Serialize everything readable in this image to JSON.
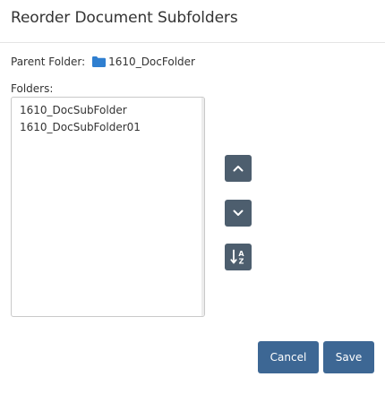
{
  "dialog": {
    "title": "Reorder Document Subfolders"
  },
  "parent_folder": {
    "label": "Parent Folder:",
    "icon": "folder-icon",
    "value": "1610_DocFolder"
  },
  "folders": {
    "label": "Folders:",
    "items": [
      {
        "label": "1610_DocSubFolder"
      },
      {
        "label": "1610_DocSubFolder01"
      }
    ]
  },
  "controls": {
    "move_up_icon": "chevron-up-icon",
    "move_down_icon": "chevron-down-icon",
    "sort_icon": "sort-alpha-icon",
    "sort_letters": [
      "A",
      "Z"
    ]
  },
  "footer": {
    "cancel_label": "Cancel",
    "save_label": "Save"
  },
  "colors": {
    "primary_button": "#3d6794",
    "icon_button": "#4d5e6e",
    "folder_icon": "#2f7fd0"
  }
}
